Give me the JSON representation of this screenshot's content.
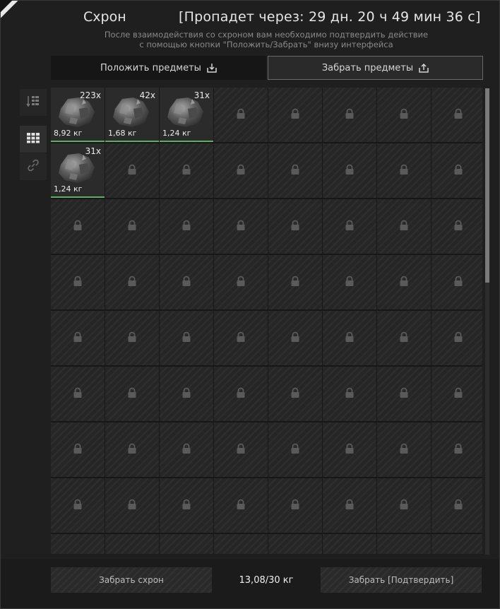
{
  "stash": {
    "title": "Схрон",
    "timer": "[Пропадет через: 29 дн. 20 ч 49 мин 36 с]",
    "notice_line1": "После взаимодействия со схроном вам необходимо подтвердить действие",
    "notice_line2": "с помощью кнопки \"Положить/Забрать\" внизу интерфейса"
  },
  "tabs": {
    "put_label": "Положить предметы",
    "take_label": "Забрать предметы",
    "active": "take"
  },
  "items": [
    {
      "icon": "ore-icon",
      "qty": "223x",
      "weight": "8,92 кг"
    },
    {
      "icon": "ore-icon",
      "qty": "42x",
      "weight": "1,68 кг"
    },
    {
      "icon": "ore-icon",
      "qty": "31x",
      "weight": "1,24 кг"
    },
    {
      "icon": "ore-icon",
      "qty": "31x",
      "weight": "1,24 кг"
    }
  ],
  "grid": {
    "columns": 8,
    "filled_slots": [
      0,
      1,
      2,
      8
    ]
  },
  "footer": {
    "take_stash_label": "Забрать схрон",
    "weight": "13,08/30 кг",
    "confirm_label": "Забрать [Подтвердить]"
  },
  "colors": {
    "accent_green": "#5fae5f",
    "panel": "#1f1f1f"
  }
}
